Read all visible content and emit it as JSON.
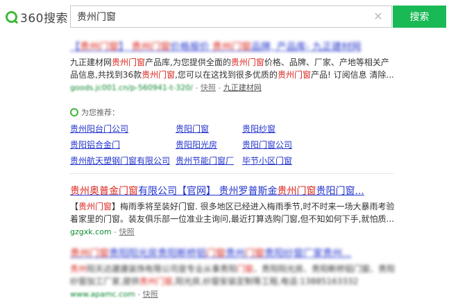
{
  "brand": {
    "name": "360搜索"
  },
  "search": {
    "query": "贵州门窗",
    "button": "搜索"
  },
  "results": [
    {
      "title_parts": [
        "【",
        "贵州门窗",
        "】 ",
        "贵州门窗",
        "价格报价  ",
        "贵州门窗",
        "品牌, 产品库- 九正建材网"
      ],
      "desc_parts": [
        "九正建材网",
        "贵州门窗",
        "产品库,为您提供全面的",
        "贵州门窗",
        "价格、品牌、厂家、产地等相关产品信息,共找到36款",
        "贵州门窗",
        ",您可以在这找到很多优质的",
        "贵州门窗",
        "产品! 订阅信息 清除..."
      ],
      "url": "goods.jc001.cn/p-560941-t-320/",
      "snapshot": "快照",
      "site": "九正建材网"
    },
    {
      "title_parts": [
        "贵州奥普金",
        "门窗",
        "有限公司【官网】 贵州罗普斯金",
        "贵州门窗",
        "贵阳门窗..."
      ],
      "desc_parts": [
        "【",
        "贵州门窗",
        "】梅雨季将至装好门窗. 很多地区已经进入梅雨季节,时不时来一场大暴雨考验着家里的门窗。装友俱乐部一位准业主询问,最近打算选购门窗,但不知如何下手,就怕质..."
      ],
      "url": "gzgxk.com",
      "snapshot": "快照"
    },
    {
      "title_parts": [
        "贵州",
        "门窗",
        "贵阳阳光房贵阳断桥铝",
        "门窗",
        "贵州",
        "门窗",
        "贵阳纱窗厂家贵州..."
      ],
      "desc_parts": [
        "贵州",
        "阳天达建建装饰有限公司是专业从事贵阳",
        "门窗",
        "、贵阳阳光房、贵阳断桥铝门窗、贵阳纱窗加工厂家,提供",
        "贵州门窗",
        ",阳光房,纱窗安装定制等工程,电话:13885163332"
      ],
      "url": "www.apamc.com",
      "snapshot": "快照"
    }
  ],
  "recommend": {
    "label": "为您推荐：",
    "items": [
      "贵州阳台门公司",
      "贵阳门窗",
      "贵阳纱窗",
      "贵阳铝合金门",
      "贵阳阳光房",
      "贵阳门窗公司",
      "贵州航天塑钢门窗有限公司",
      "贵州节能门窗厂",
      "毕节小区门窗"
    ]
  }
}
